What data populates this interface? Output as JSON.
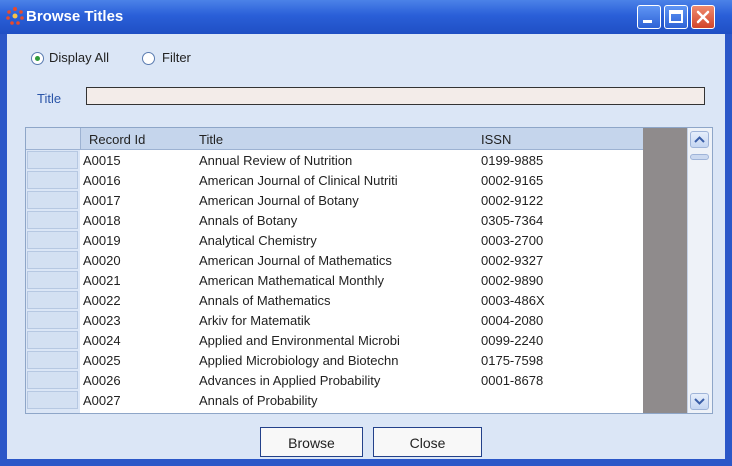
{
  "window": {
    "title": "Browse Titles",
    "controls": {
      "minimize": "minimize-icon",
      "maximize": "maximize-icon",
      "close": "close-icon"
    }
  },
  "mode": {
    "options": [
      {
        "label": "Display All",
        "selected": true
      },
      {
        "label": "Filter",
        "selected": false
      }
    ]
  },
  "filter": {
    "label": "Title",
    "value": ""
  },
  "table": {
    "columns": [
      "Record Id",
      "Title",
      "ISSN"
    ],
    "rows": [
      {
        "id": "A0015",
        "title": "Annual Review of Nutrition",
        "issn": "0199-9885"
      },
      {
        "id": "A0016",
        "title": "American Journal of Clinical Nutriti",
        "issn": "0002-9165"
      },
      {
        "id": "A0017",
        "title": "American Journal of Botany",
        "issn": "0002-9122"
      },
      {
        "id": "A0018",
        "title": "Annals of Botany",
        "issn": "0305-7364"
      },
      {
        "id": "A0019",
        "title": "Analytical Chemistry",
        "issn": "0003-2700"
      },
      {
        "id": "A0020",
        "title": "American Journal of Mathematics",
        "issn": "0002-9327"
      },
      {
        "id": "A0021",
        "title": "American Mathematical Monthly",
        "issn": "0002-9890"
      },
      {
        "id": "A0022",
        "title": "Annals of Mathematics",
        "issn": "0003-486X"
      },
      {
        "id": "A0023",
        "title": "Arkiv for Matematik",
        "issn": "0004-2080"
      },
      {
        "id": "A0024",
        "title": "Applied and Environmental Microbi",
        "issn": "0099-2240"
      },
      {
        "id": "A0025",
        "title": "Applied Microbiology and Biotechn",
        "issn": "0175-7598"
      },
      {
        "id": "A0026",
        "title": "Advances in Applied Probability",
        "issn": "0001-8678"
      },
      {
        "id": "A0027",
        "title": "Annals of Probability",
        "issn": ""
      }
    ]
  },
  "buttons": {
    "browse": "Browse",
    "close": "Close"
  }
}
